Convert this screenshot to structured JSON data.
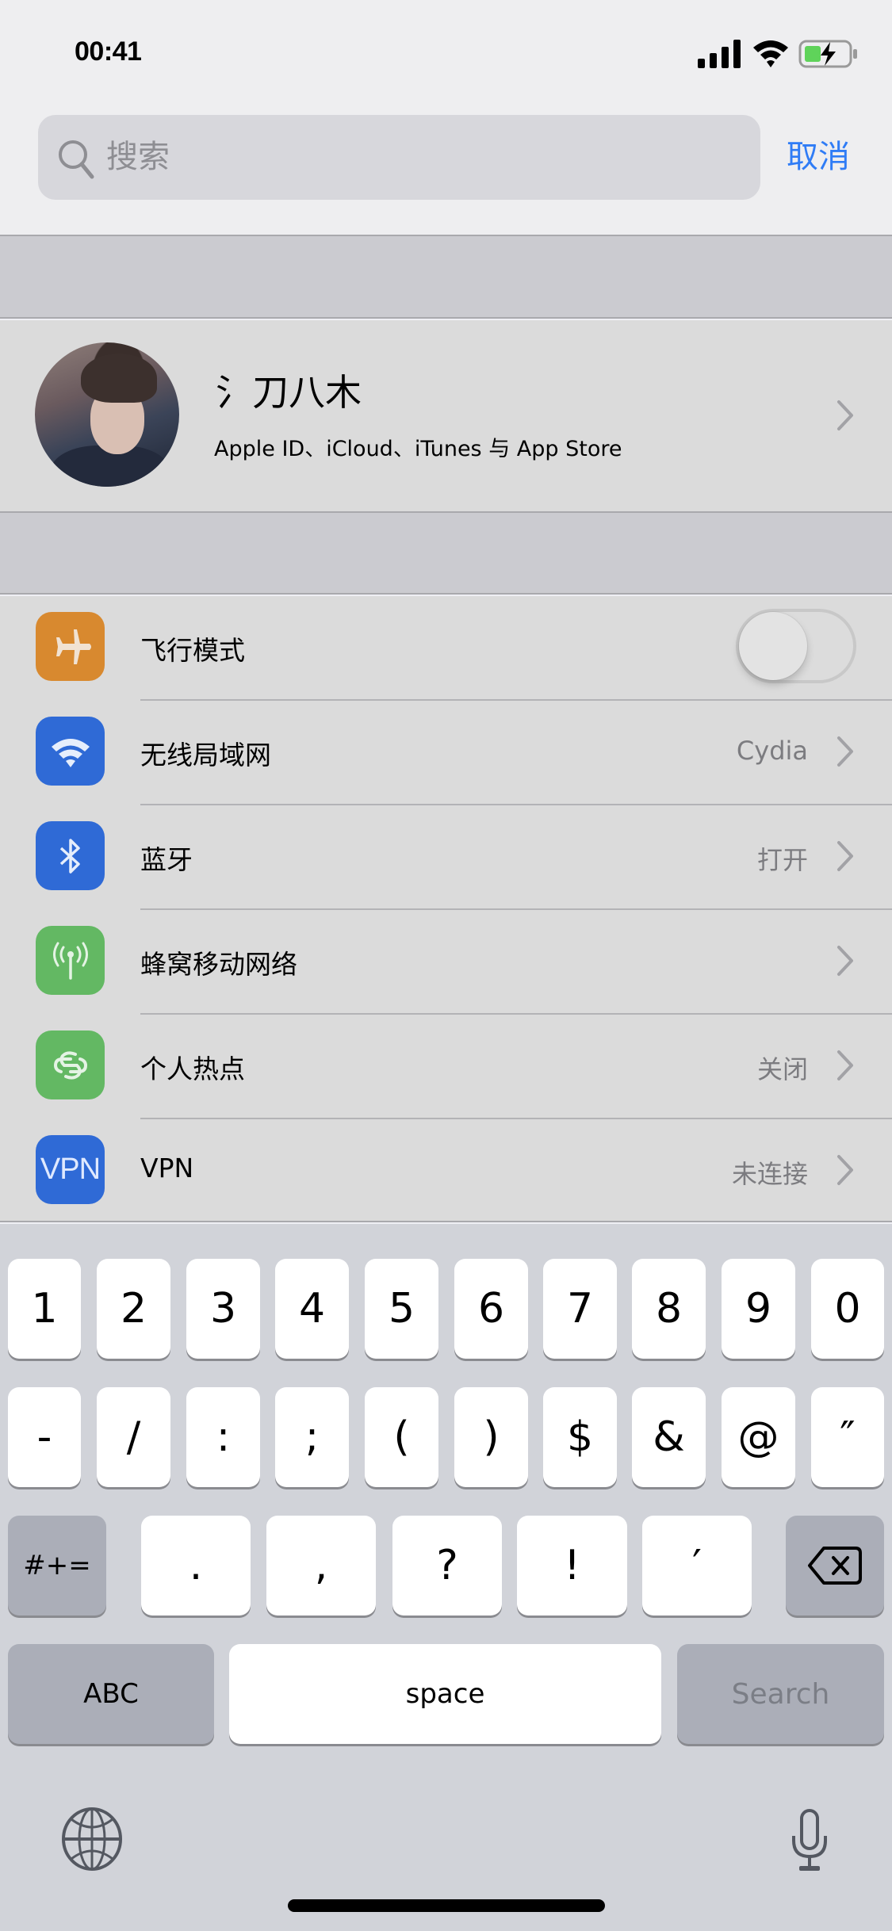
{
  "status_bar": {
    "time": "00:41",
    "icons": [
      "cellular-signal-icon",
      "wifi-icon",
      "battery-charging-icon"
    ],
    "battery_color": "#5fd35a"
  },
  "search": {
    "placeholder": "搜索",
    "value": "",
    "cancel_label": "取消",
    "accent_color": "#2f7cf6"
  },
  "profile": {
    "name": "氵刀八木",
    "subtitle": "Apple ID、iCloud、iTunes 与 App Store",
    "avatar": "user-photo"
  },
  "settings": [
    {
      "label": "飞行模式",
      "icon": "airplane-icon",
      "icon_color": "#d8892f",
      "control": "toggle",
      "toggle_on": false
    },
    {
      "label": "无线局域网",
      "icon": "wifi-icon",
      "icon_color": "#2f6ad6",
      "value": "Cydia",
      "control": "chevron"
    },
    {
      "label": "蓝牙",
      "icon": "bluetooth-icon",
      "icon_color": "#2f6ad6",
      "value": "打开",
      "control": "chevron"
    },
    {
      "label": "蜂窝移动网络",
      "icon": "cellular-antenna-icon",
      "icon_color": "#63b863",
      "value": "",
      "control": "chevron"
    },
    {
      "label": "个人热点",
      "icon": "hotspot-link-icon",
      "icon_color": "#63b863",
      "value": "关闭",
      "control": "chevron"
    },
    {
      "label": "VPN",
      "icon": "vpn-icon",
      "icon_text": "VPN",
      "icon_color": "#2f6ad6",
      "value": "未连接",
      "control": "chevron"
    }
  ],
  "keyboard": {
    "row1": [
      "1",
      "2",
      "3",
      "4",
      "5",
      "6",
      "7",
      "8",
      "9",
      "0"
    ],
    "row2": [
      "-",
      "/",
      ":",
      ";",
      "(",
      ")",
      "$",
      "&",
      "@",
      "″"
    ],
    "row3": {
      "mode_key": "#+=",
      "keys": [
        ".",
        ",",
        "?",
        "!",
        "′"
      ],
      "delete_icon": "backspace-icon"
    },
    "row4": {
      "abc_label": "ABC",
      "space_label": "space",
      "search_label": "Search"
    },
    "bottom_icons": [
      "globe-icon",
      "microphone-icon"
    ]
  }
}
